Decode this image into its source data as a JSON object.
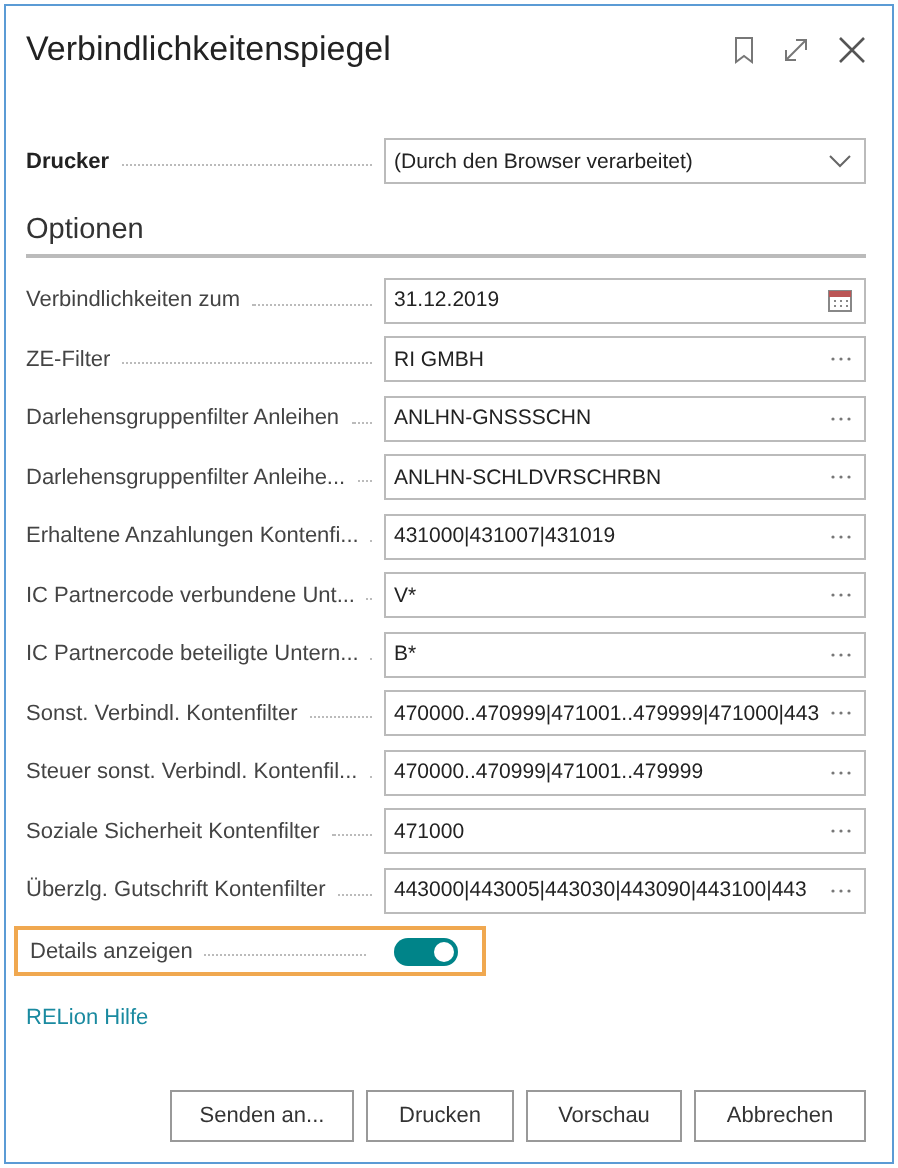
{
  "window": {
    "title": "Verbindlichkeitenspiegel"
  },
  "printer": {
    "label": "Drucker",
    "value": "(Durch den Browser verarbeitet)"
  },
  "section": {
    "title": "Optionen"
  },
  "fields": [
    {
      "label": "Verbindlichkeiten zum",
      "value": "31.12.2019",
      "kind": "date"
    },
    {
      "label": "ZE-Filter",
      "value": "RI GMBH",
      "kind": "lookup"
    },
    {
      "label": "Darlehensgruppenfilter Anleihen",
      "value": "ANLHN-GNSSSCHN",
      "kind": "lookup"
    },
    {
      "label": "Darlehensgruppenfilter Anleihe...",
      "value": "ANLHN-SCHLDVRSCHRBN",
      "kind": "lookup"
    },
    {
      "label": "Erhaltene Anzahlungen Kontenfi...",
      "value": "431000|431007|431019",
      "kind": "lookup"
    },
    {
      "label": "IC Partnercode verbundene Unt...",
      "value": "V*",
      "kind": "lookup"
    },
    {
      "label": "IC Partnercode beteiligte Untern...",
      "value": "B*",
      "kind": "lookup"
    },
    {
      "label": "Sonst. Verbindl. Kontenfilter",
      "value": "470000..470999|471001..479999|471000|443",
      "kind": "lookup"
    },
    {
      "label": "Steuer sonst. Verbindl. Kontenfil...",
      "value": "470000..470999|471001..479999",
      "kind": "lookup"
    },
    {
      "label": "Soziale Sicherheit Kontenfilter",
      "value": "471000",
      "kind": "lookup"
    },
    {
      "label": "Überzlg. Gutschrift Kontenfilter",
      "value": "443000|443005|443030|443090|443100|443",
      "kind": "lookup"
    }
  ],
  "toggle": {
    "label": "Details anzeigen",
    "on": true,
    "focused": true
  },
  "help_link": "RELion Hilfe",
  "buttons": [
    "Senden an...",
    "Drucken",
    "Vorschau",
    "Abbrechen"
  ]
}
